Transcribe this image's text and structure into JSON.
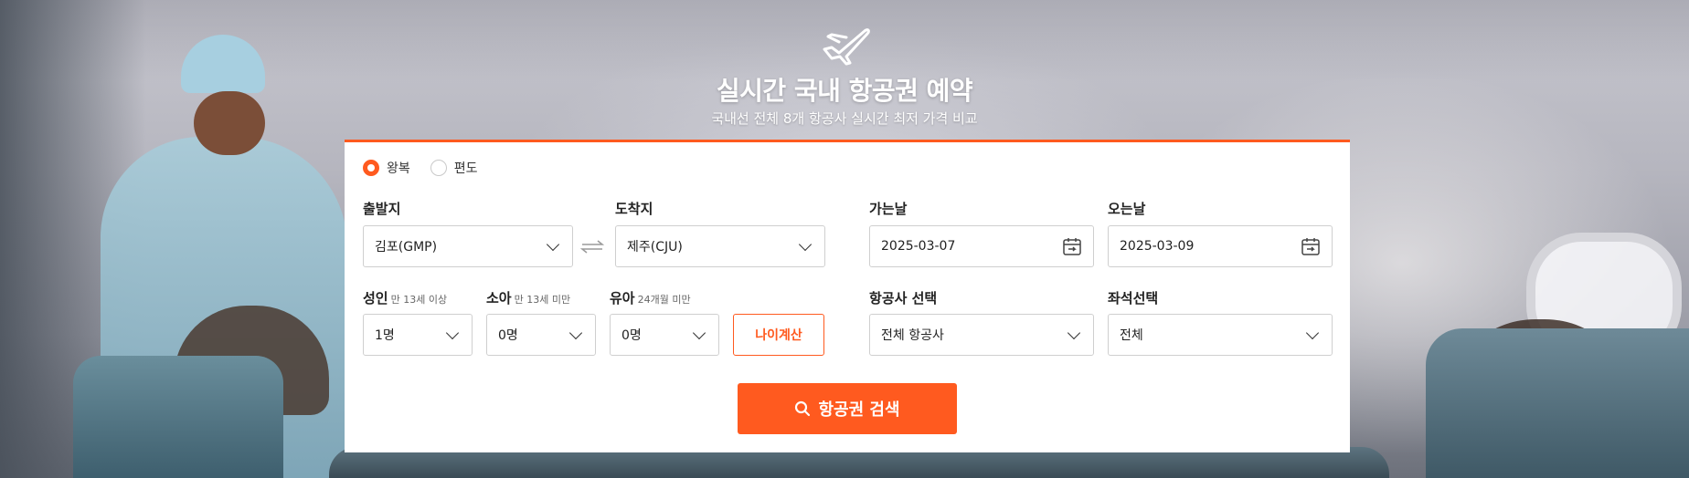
{
  "hero": {
    "title": "실시간 국내 항공권 예약",
    "subtitle": "국내선 전체 8개 항공사 실시간 최저 가격 비교",
    "icon": "airplane-icon"
  },
  "trip_type": {
    "options": [
      {
        "label": "왕복",
        "selected": true
      },
      {
        "label": "편도",
        "selected": false
      }
    ]
  },
  "route": {
    "departure_label": "출발지",
    "departure_value": "김포(GMP)",
    "arrival_label": "도착지",
    "arrival_value": "제주(CJU)",
    "swap_icon": "swap-arrows-icon"
  },
  "dates": {
    "depart_label": "가는날",
    "depart_value": "2025-03-07",
    "return_label": "오는날",
    "return_value": "2025-03-09",
    "icon": "calendar-icon"
  },
  "passengers": {
    "adult_label": "성인",
    "adult_hint": "만 13세 이상",
    "adult_value": "1명",
    "child_label": "소아",
    "child_hint": "만 13세 미만",
    "child_value": "0명",
    "infant_label": "유아",
    "infant_hint": "24개월 미만",
    "infant_value": "0명",
    "age_calc_label": "나이계산"
  },
  "airline": {
    "label": "항공사 선택",
    "value": "전체 항공사"
  },
  "seat": {
    "label": "좌석선택",
    "value": "전체"
  },
  "search": {
    "label": "항공권 검색",
    "icon": "search-icon"
  },
  "colors": {
    "accent": "#ff5a1f"
  }
}
